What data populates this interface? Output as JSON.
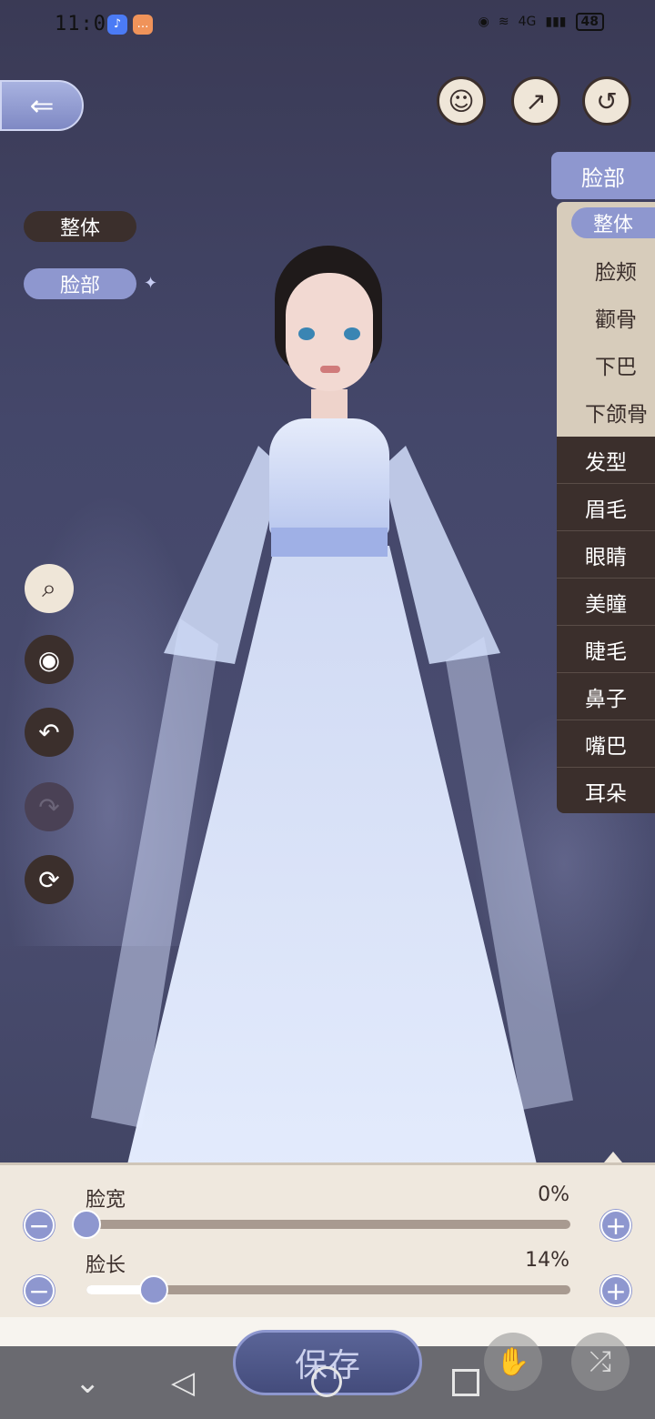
{
  "status_bar": {
    "time": "11:09",
    "battery": "48",
    "network": "4G"
  },
  "header": {
    "back_label": "",
    "icons": [
      "face-profile-icon",
      "share-icon",
      "reset-icon"
    ]
  },
  "modes": {
    "whole": "整体",
    "face": "脸部"
  },
  "category_menu": {
    "active_category": "脸部",
    "sub_items": [
      {
        "label": "整体",
        "active": true
      },
      {
        "label": "脸颊",
        "active": false
      },
      {
        "label": "颧骨",
        "active": false
      },
      {
        "label": "下巴",
        "active": false
      },
      {
        "label": "下颌骨",
        "active": false
      }
    ],
    "categories": [
      "发型",
      "眉毛",
      "眼睛",
      "美瞳",
      "睫毛",
      "鼻子",
      "嘴巴",
      "耳朵"
    ]
  },
  "tools": [
    "camera-zoom-icon",
    "eye-icon",
    "undo-icon",
    "redo-icon",
    "rotate-icon"
  ],
  "sliders": [
    {
      "label": "脸宽",
      "value_text": "0%",
      "value": 0
    },
    {
      "label": "脸长",
      "value_text": "14%",
      "value": 14
    }
  ],
  "footer": {
    "save_label": "保存"
  },
  "colors": {
    "accent": "#8e97cf",
    "dark": "#3b2f2c",
    "panel": "#efe8de"
  }
}
